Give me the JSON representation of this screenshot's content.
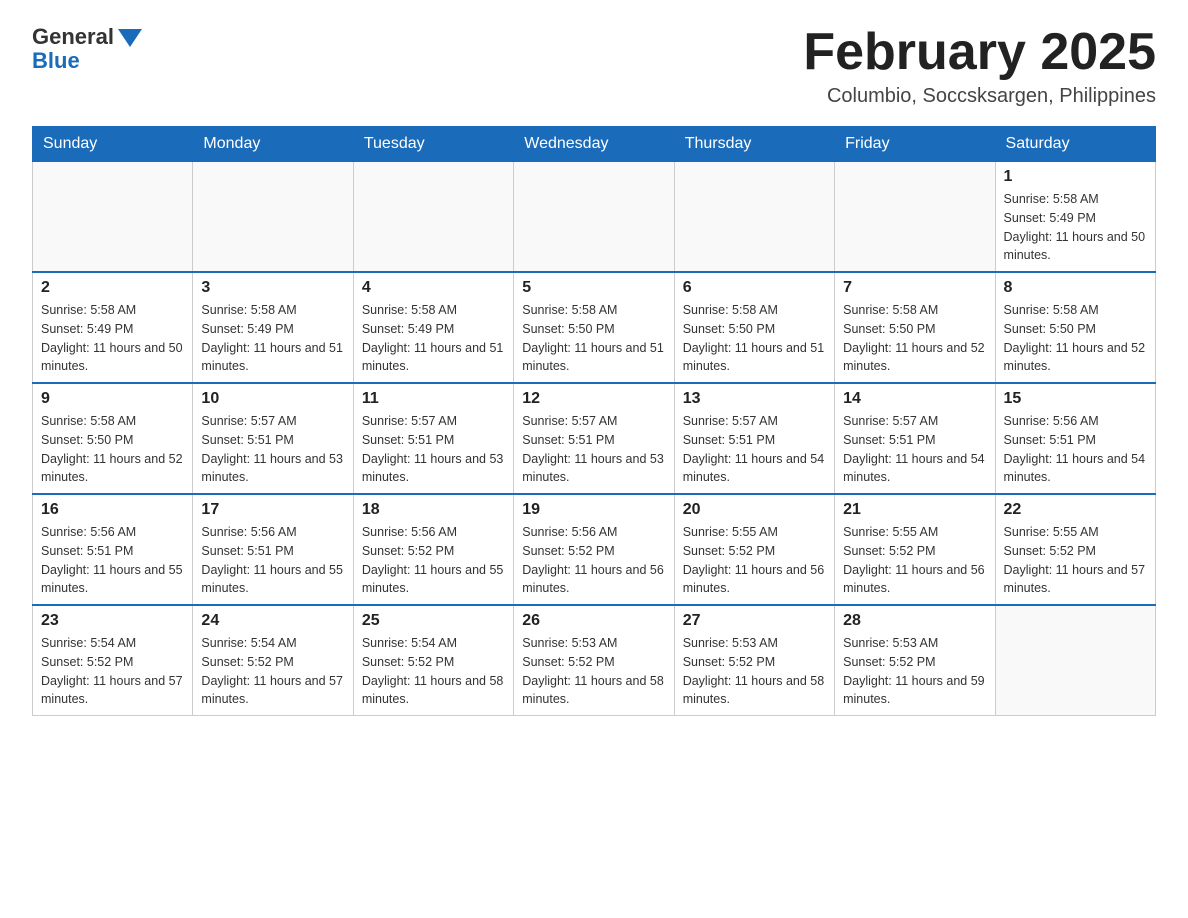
{
  "logo": {
    "text_general": "General",
    "text_blue": "Blue"
  },
  "header": {
    "month_title": "February 2025",
    "subtitle": "Columbio, Soccsksargen, Philippines"
  },
  "weekdays": [
    "Sunday",
    "Monday",
    "Tuesday",
    "Wednesday",
    "Thursday",
    "Friday",
    "Saturday"
  ],
  "weeks": [
    [
      {
        "day": "",
        "sunrise": "",
        "sunset": "",
        "daylight": ""
      },
      {
        "day": "",
        "sunrise": "",
        "sunset": "",
        "daylight": ""
      },
      {
        "day": "",
        "sunrise": "",
        "sunset": "",
        "daylight": ""
      },
      {
        "day": "",
        "sunrise": "",
        "sunset": "",
        "daylight": ""
      },
      {
        "day": "",
        "sunrise": "",
        "sunset": "",
        "daylight": ""
      },
      {
        "day": "",
        "sunrise": "",
        "sunset": "",
        "daylight": ""
      },
      {
        "day": "1",
        "sunrise": "Sunrise: 5:58 AM",
        "sunset": "Sunset: 5:49 PM",
        "daylight": "Daylight: 11 hours and 50 minutes."
      }
    ],
    [
      {
        "day": "2",
        "sunrise": "Sunrise: 5:58 AM",
        "sunset": "Sunset: 5:49 PM",
        "daylight": "Daylight: 11 hours and 50 minutes."
      },
      {
        "day": "3",
        "sunrise": "Sunrise: 5:58 AM",
        "sunset": "Sunset: 5:49 PM",
        "daylight": "Daylight: 11 hours and 51 minutes."
      },
      {
        "day": "4",
        "sunrise": "Sunrise: 5:58 AM",
        "sunset": "Sunset: 5:49 PM",
        "daylight": "Daylight: 11 hours and 51 minutes."
      },
      {
        "day": "5",
        "sunrise": "Sunrise: 5:58 AM",
        "sunset": "Sunset: 5:50 PM",
        "daylight": "Daylight: 11 hours and 51 minutes."
      },
      {
        "day": "6",
        "sunrise": "Sunrise: 5:58 AM",
        "sunset": "Sunset: 5:50 PM",
        "daylight": "Daylight: 11 hours and 51 minutes."
      },
      {
        "day": "7",
        "sunrise": "Sunrise: 5:58 AM",
        "sunset": "Sunset: 5:50 PM",
        "daylight": "Daylight: 11 hours and 52 minutes."
      },
      {
        "day": "8",
        "sunrise": "Sunrise: 5:58 AM",
        "sunset": "Sunset: 5:50 PM",
        "daylight": "Daylight: 11 hours and 52 minutes."
      }
    ],
    [
      {
        "day": "9",
        "sunrise": "Sunrise: 5:58 AM",
        "sunset": "Sunset: 5:50 PM",
        "daylight": "Daylight: 11 hours and 52 minutes."
      },
      {
        "day": "10",
        "sunrise": "Sunrise: 5:57 AM",
        "sunset": "Sunset: 5:51 PM",
        "daylight": "Daylight: 11 hours and 53 minutes."
      },
      {
        "day": "11",
        "sunrise": "Sunrise: 5:57 AM",
        "sunset": "Sunset: 5:51 PM",
        "daylight": "Daylight: 11 hours and 53 minutes."
      },
      {
        "day": "12",
        "sunrise": "Sunrise: 5:57 AM",
        "sunset": "Sunset: 5:51 PM",
        "daylight": "Daylight: 11 hours and 53 minutes."
      },
      {
        "day": "13",
        "sunrise": "Sunrise: 5:57 AM",
        "sunset": "Sunset: 5:51 PM",
        "daylight": "Daylight: 11 hours and 54 minutes."
      },
      {
        "day": "14",
        "sunrise": "Sunrise: 5:57 AM",
        "sunset": "Sunset: 5:51 PM",
        "daylight": "Daylight: 11 hours and 54 minutes."
      },
      {
        "day": "15",
        "sunrise": "Sunrise: 5:56 AM",
        "sunset": "Sunset: 5:51 PM",
        "daylight": "Daylight: 11 hours and 54 minutes."
      }
    ],
    [
      {
        "day": "16",
        "sunrise": "Sunrise: 5:56 AM",
        "sunset": "Sunset: 5:51 PM",
        "daylight": "Daylight: 11 hours and 55 minutes."
      },
      {
        "day": "17",
        "sunrise": "Sunrise: 5:56 AM",
        "sunset": "Sunset: 5:51 PM",
        "daylight": "Daylight: 11 hours and 55 minutes."
      },
      {
        "day": "18",
        "sunrise": "Sunrise: 5:56 AM",
        "sunset": "Sunset: 5:52 PM",
        "daylight": "Daylight: 11 hours and 55 minutes."
      },
      {
        "day": "19",
        "sunrise": "Sunrise: 5:56 AM",
        "sunset": "Sunset: 5:52 PM",
        "daylight": "Daylight: 11 hours and 56 minutes."
      },
      {
        "day": "20",
        "sunrise": "Sunrise: 5:55 AM",
        "sunset": "Sunset: 5:52 PM",
        "daylight": "Daylight: 11 hours and 56 minutes."
      },
      {
        "day": "21",
        "sunrise": "Sunrise: 5:55 AM",
        "sunset": "Sunset: 5:52 PM",
        "daylight": "Daylight: 11 hours and 56 minutes."
      },
      {
        "day": "22",
        "sunrise": "Sunrise: 5:55 AM",
        "sunset": "Sunset: 5:52 PM",
        "daylight": "Daylight: 11 hours and 57 minutes."
      }
    ],
    [
      {
        "day": "23",
        "sunrise": "Sunrise: 5:54 AM",
        "sunset": "Sunset: 5:52 PM",
        "daylight": "Daylight: 11 hours and 57 minutes."
      },
      {
        "day": "24",
        "sunrise": "Sunrise: 5:54 AM",
        "sunset": "Sunset: 5:52 PM",
        "daylight": "Daylight: 11 hours and 57 minutes."
      },
      {
        "day": "25",
        "sunrise": "Sunrise: 5:54 AM",
        "sunset": "Sunset: 5:52 PM",
        "daylight": "Daylight: 11 hours and 58 minutes."
      },
      {
        "day": "26",
        "sunrise": "Sunrise: 5:53 AM",
        "sunset": "Sunset: 5:52 PM",
        "daylight": "Daylight: 11 hours and 58 minutes."
      },
      {
        "day": "27",
        "sunrise": "Sunrise: 5:53 AM",
        "sunset": "Sunset: 5:52 PM",
        "daylight": "Daylight: 11 hours and 58 minutes."
      },
      {
        "day": "28",
        "sunrise": "Sunrise: 5:53 AM",
        "sunset": "Sunset: 5:52 PM",
        "daylight": "Daylight: 11 hours and 59 minutes."
      },
      {
        "day": "",
        "sunrise": "",
        "sunset": "",
        "daylight": ""
      }
    ]
  ]
}
